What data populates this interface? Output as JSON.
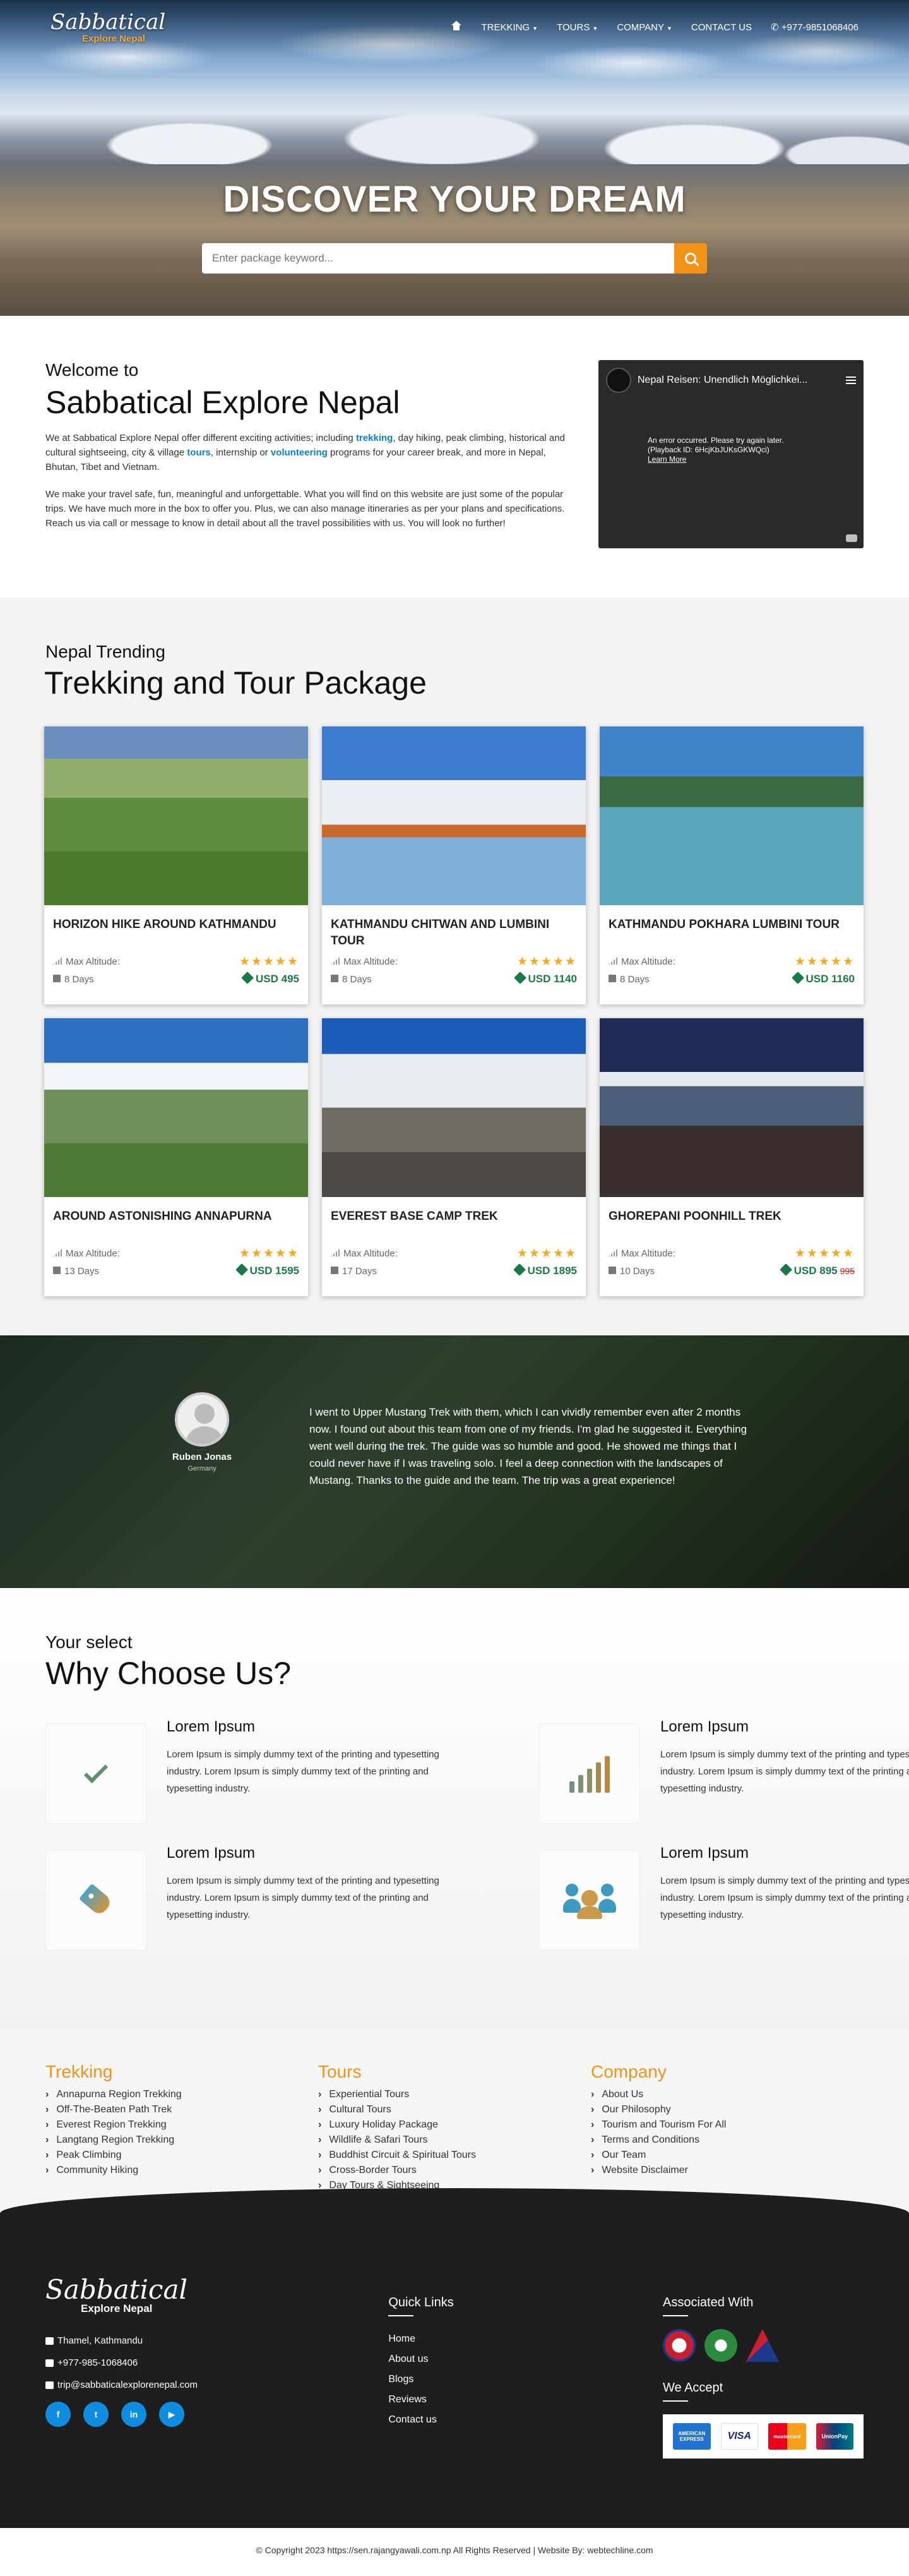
{
  "nav": {
    "logo_top": "Sabbatical",
    "logo_bottom": "Explore Nepal",
    "items": [
      "TREKKING",
      "TOURS",
      "COMPANY",
      "CONTACT US"
    ],
    "phone": "+977-9851068406"
  },
  "hero": {
    "title": "DISCOVER YOUR DREAM",
    "search_placeholder": "Enter package keyword..."
  },
  "welcome": {
    "kicker": "Welcome to",
    "title": "Sabbatical Explore Nepal",
    "p1_a": "We at Sabbatical Explore Nepal offer different exciting activities; including ",
    "p1_link1": "trekking",
    "p1_b": ", day hiking, peak climbing, historical and cultural sightseeing, city & village ",
    "p1_link2": "tours",
    "p1_c": ", internship or ",
    "p1_link3": "volunteering",
    "p1_d": " programs for your career break, and more in Nepal, Bhutan, Tibet and Vietnam.",
    "p2": "We make your travel safe, fun, meaningful and unforgettable. What you will find on this website are just some of the popular trips. We have much more in the box to offer you. Plus, we can also manage itineraries as per your plans and specifications. Reach us via call or message to know in detail about all the travel possibilities with us. You will look no further!",
    "video_title": "Nepal Reisen: Unendlich Möglichkei...",
    "video_error1": "An error occurred. Please try again later.",
    "video_error2": "(Playback ID: 6HcjKbJUKsGKWQci)",
    "video_learn": "Learn More"
  },
  "packages": {
    "kicker": "Nepal Trending",
    "title": "Trekking and Tour Package",
    "altitude_label": "Max Altitude:",
    "items": [
      {
        "title": "HORIZON HIKE AROUND KATHMANDU",
        "days": "8 Days",
        "price": "USD 495",
        "old": ""
      },
      {
        "title": "KATHMANDU CHITWAN AND LUMBINI TOUR",
        "days": "8 Days",
        "price": "USD 1140",
        "old": ""
      },
      {
        "title": "KATHMANDU POKHARA LUMBINI TOUR",
        "days": "8 Days",
        "price": "USD 1160",
        "old": ""
      },
      {
        "title": "AROUND ASTONISHING ANNAPURNA",
        "days": "13 Days",
        "price": "USD 1595",
        "old": ""
      },
      {
        "title": "EVEREST BASE CAMP TREK",
        "days": "17 Days",
        "price": "USD 1895",
        "old": ""
      },
      {
        "title": "GHOREPANI POONHILL TREK",
        "days": "10 Days",
        "price": "USD 895",
        "old": "995"
      }
    ],
    "stars": "★★★★★"
  },
  "testimonial": {
    "name": "Ruben Jonas",
    "country": "Germany",
    "quote": "I went to Upper Mustang Trek with them, which I can vividly remember even after 2 months now. I found out about this team from one of my friends. I'm glad he suggested it. Everything went well during the trek. The guide was so humble and good. He showed me things that I could never have if I was traveling solo. I feel a deep connection with the landscapes of Mustang. Thanks to the guide and the team. The trip was a great experience!"
  },
  "why": {
    "kicker": "Your select",
    "title": "Why Choose Us?",
    "items": [
      {
        "title": "Lorem Ipsum",
        "text": "Lorem Ipsum is simply dummy text of the printing and typesetting industry. Lorem Ipsum is simply dummy text of the printing and typesetting industry.",
        "icon": "check-icon"
      },
      {
        "title": "Lorem Ipsum",
        "text": "Lorem Ipsum is simply dummy text of the printing and typesetting industry. Lorem Ipsum is simply dummy text of the printing and typesetting industry.",
        "icon": "signal-bars-icon"
      },
      {
        "title": "Lorem Ipsum",
        "text": "Lorem Ipsum is simply dummy text of the printing and typesetting industry. Lorem Ipsum is simply dummy text of the printing and typesetting industry.",
        "icon": "tag-icon"
      },
      {
        "title": "Lorem Ipsum",
        "text": "Lorem Ipsum is simply dummy text of the printing and typesetting industry. Lorem Ipsum is simply dummy text of the printing and typesetting industry.",
        "icon": "people-icon"
      }
    ]
  },
  "links": {
    "trekking": {
      "title": "Trekking",
      "items": [
        "Annapurna Region Trekking",
        "Off-The-Beaten Path Trek",
        "Everest Region Trekking",
        "Langtang Region Trekking",
        "Peak Climbing",
        "Community Hiking"
      ]
    },
    "tours": {
      "title": "Tours",
      "items": [
        "Experiential Tours",
        "Cultural Tours",
        "Luxury Holiday Package",
        "Wildlife & Safari Tours",
        "Buddhist Circuit & Spiritual Tours",
        "Cross-Border Tours",
        "Day Tours & Sightseeing"
      ]
    },
    "company": {
      "title": "Company",
      "items": [
        "About Us",
        "Our Philosophy",
        "Tourism and Tourism For All",
        "Terms and Conditions",
        "Our Team",
        "Website Disclaimer"
      ]
    }
  },
  "footer": {
    "logo_top": "Sabbatical",
    "logo_bottom": "Explore Nepal",
    "address": "Thamel, Kathmandu",
    "phone": "+977-985-1068406",
    "email": "trip@sabbaticalexplorenepal.com",
    "quick_title": "Quick Links",
    "quick": [
      "Home",
      "About us",
      "Blogs",
      "Reviews",
      "Contact us"
    ],
    "assoc_title": "Associated With",
    "accept_title": "We Accept",
    "cards": [
      "AMERICAN EXPRESS",
      "VISA",
      "mastercard",
      "UnionPay"
    ],
    "copyright": "© Copyright 2023 https://sen.rajangyawali.com.np All Rights Reserved | Website By: webtechline.com"
  },
  "colors": {
    "accent": "#f29318",
    "link": "#0b7fd6",
    "price": "#1a7a47"
  }
}
